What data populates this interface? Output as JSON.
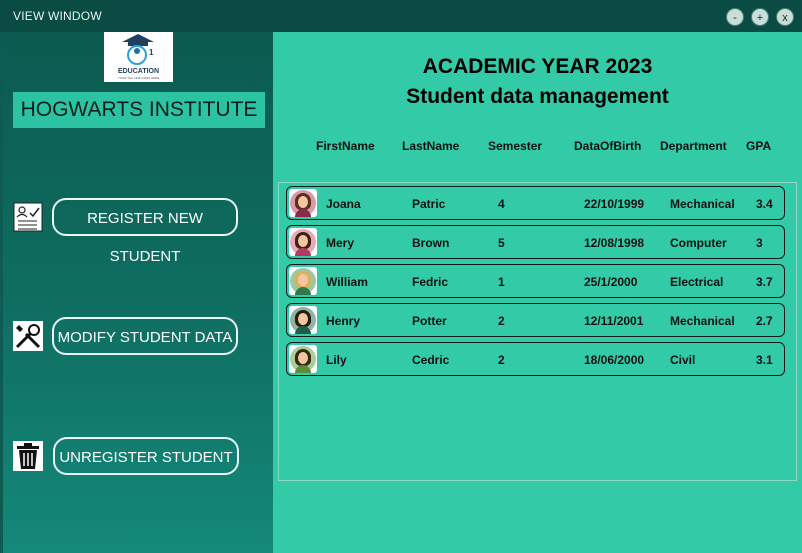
{
  "window": {
    "title": "VIEW WINDOW",
    "buttons": {
      "minimize": "-",
      "maximize": "+",
      "close": "x"
    }
  },
  "sidebar": {
    "logo_text": "EDUCATION",
    "logo_sub": "YOUR TAG LINE GOES HERE",
    "logo_badge": "1",
    "institute": "HOGWARTS INSTITUTE",
    "nav": [
      {
        "label": "REGISTER NEW STUDENT",
        "icon": "register-form-icon"
      },
      {
        "label": "MODIFY STUDENT DATA",
        "icon": "tools-icon"
      },
      {
        "label": "UNREGISTER STUDENT",
        "icon": "trash-icon"
      }
    ]
  },
  "main": {
    "heading1": "ACADEMIC YEAR 2023",
    "heading2": "Student data management",
    "columns": [
      "FirstName",
      "LastName",
      "Semester",
      "DataOfBirth",
      "Department",
      "GPA"
    ],
    "rows": [
      {
        "first": "Joana",
        "last": "Patric",
        "semester": "4",
        "dob": "22/10/1999",
        "dept": "Mechanical",
        "gpa": "3.4",
        "avatar": {
          "bg": "#d99aa8",
          "hair": "#5a2f1c",
          "body": "#8a2a4a"
        }
      },
      {
        "first": "Mery",
        "last": "Brown",
        "semester": "5",
        "dob": "12/08/1998",
        "dept": "Computer",
        "gpa": "3",
        "avatar": {
          "bg": "#e7a9b6",
          "hair": "#3d2217",
          "body": "#b23a62"
        }
      },
      {
        "first": "William",
        "last": "Fedric",
        "semester": "1",
        "dob": "25/1/2000",
        "dept": "Electrical",
        "gpa": "3.7",
        "avatar": {
          "bg": "#9cc7a0",
          "hair": "#d9b35a",
          "body": "#2f7a4a"
        }
      },
      {
        "first": "Henry",
        "last": "Potter",
        "semester": "2",
        "dob": "12/11/2001",
        "dept": "Mechanical",
        "gpa": "2.7",
        "avatar": {
          "bg": "#8fb5a0",
          "hair": "#2b1a12",
          "body": "#1f5e46"
        }
      },
      {
        "first": "Lily",
        "last": "Cedric",
        "semester": "2",
        "dob": "18/06/2000",
        "dept": "Civil",
        "gpa": "3.1",
        "avatar": {
          "bg": "#a8cf98",
          "hair": "#3a2418",
          "body": "#5b8c3a"
        }
      }
    ]
  }
}
